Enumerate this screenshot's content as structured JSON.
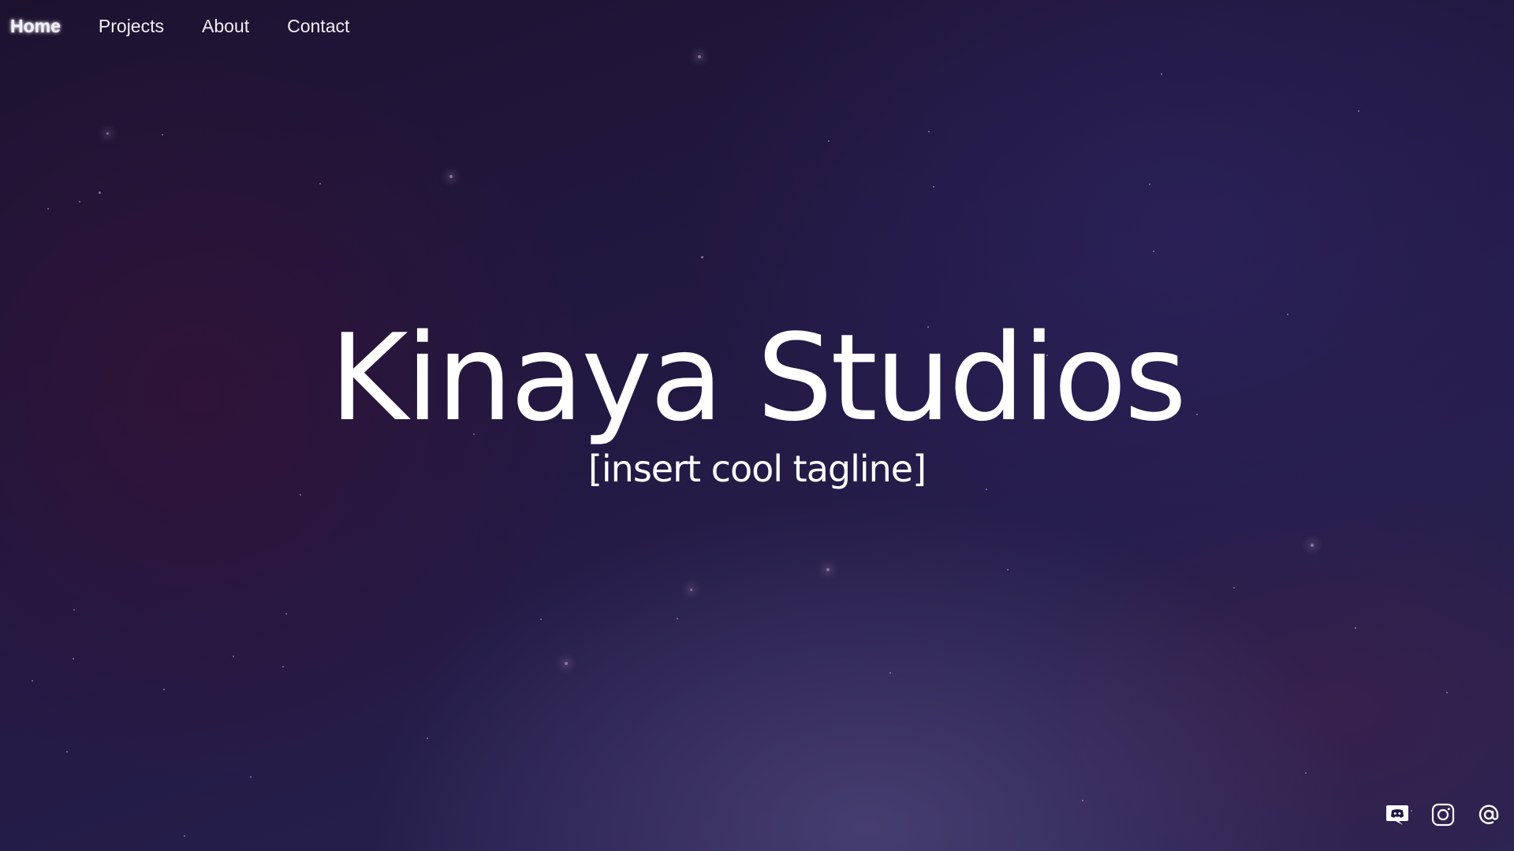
{
  "nav": {
    "items": [
      {
        "label": "Home",
        "active": true
      },
      {
        "label": "Projects",
        "active": false
      },
      {
        "label": "About",
        "active": false
      },
      {
        "label": "Contact",
        "active": false
      }
    ]
  },
  "hero": {
    "title": "Kinaya Studios",
    "tagline": "[insert cool tagline]"
  },
  "social": {
    "icons": [
      "discord-icon",
      "instagram-icon",
      "at-sign-icon"
    ]
  },
  "colors": {
    "background": "#1b1333",
    "text": "#ffffff",
    "accent": "#2a2452"
  }
}
